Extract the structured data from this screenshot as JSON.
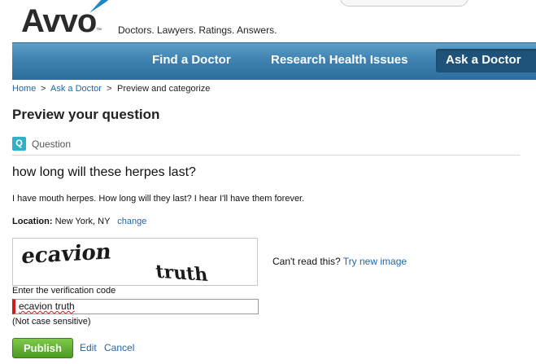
{
  "header": {
    "logo_text": "Avvo",
    "logo_tm": "™",
    "tagline": "Doctors. Lawyers. Ratings. Answers."
  },
  "nav": {
    "items": [
      {
        "label": "Find a Doctor"
      },
      {
        "label": "Research Health Issues"
      },
      {
        "label": "Ask a Doctor"
      }
    ],
    "active_color": "#1f5278"
  },
  "breadcrumb": {
    "items": [
      "Home",
      "Ask a Doctor",
      "Preview and categorize"
    ],
    "separator": ">"
  },
  "page": {
    "title": "Preview your question",
    "section_badge": "Q",
    "section_label": "Question"
  },
  "question": {
    "title": "how long will these herpes last?",
    "body": "I have mouth herpes. How long will they last? I hear I'll have them forever.",
    "location_label": "Location:",
    "location_value": "New York, NY",
    "location_change": "change"
  },
  "captcha": {
    "word1": "ecavion",
    "word2": "truth",
    "cant_read": "Can't read this?",
    "try_new": "Try new image",
    "verify_label": "Enter the verification code",
    "input_value": "ecavion truth",
    "note": "(Not case sensitive)"
  },
  "actions": {
    "publish": "Publish",
    "edit": "Edit",
    "cancel": "Cancel"
  },
  "colors": {
    "link": "#1f66a8",
    "publish_green": "#4a9a22",
    "badge_teal": "#2fb0c8",
    "error_red": "#d01b1b"
  }
}
